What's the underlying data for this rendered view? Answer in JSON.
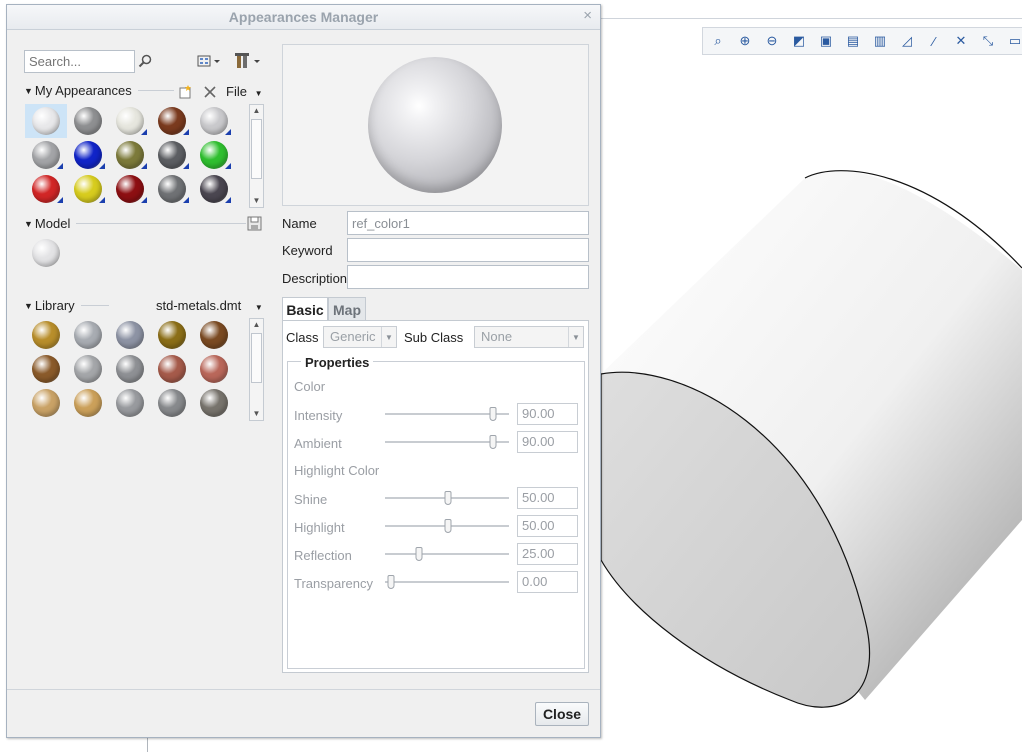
{
  "dialog": {
    "title": "Appearances Manager",
    "close_glyph": "×",
    "search_placeholder": "Search...",
    "my_appearances": {
      "label": "My Appearances",
      "file_menu": "File",
      "swatches": [
        {
          "color": "#e8e8ea",
          "corner": false,
          "selected": true
        },
        {
          "color": "#8e8f91",
          "corner": false
        },
        {
          "color": "#e6e6de",
          "corner": true
        },
        {
          "color": "#7a3a1e",
          "corner": true
        },
        {
          "color": "#c9c9cc",
          "corner": true
        },
        {
          "color": "#a3a4a7",
          "corner": true
        },
        {
          "color": "#1024c8",
          "corner": true
        },
        {
          "color": "#7c7a3a",
          "corner": true
        },
        {
          "color": "#5c5e62",
          "corner": true
        },
        {
          "color": "#2fbf2f",
          "corner": true
        },
        {
          "color": "#d12626",
          "corner": true
        },
        {
          "color": "#d7cc1e",
          "corner": true
        },
        {
          "color": "#8d0f12",
          "corner": true
        },
        {
          "color": "#6f7174",
          "corner": true
        },
        {
          "color": "#4a4650",
          "corner": true
        }
      ]
    },
    "model": {
      "label": "Model",
      "swatches": [
        {
          "color": "#e3e3e5"
        }
      ]
    },
    "library": {
      "label": "Library",
      "file": "std-metals.dmt",
      "swatches": [
        {
          "color": "#b88e2b"
        },
        {
          "color": "#a8acb2"
        },
        {
          "color": "#8d93a4"
        },
        {
          "color": "#8b6e17"
        },
        {
          "color": "#7a4a22"
        },
        {
          "color": "#8a5a2a"
        },
        {
          "color": "#a4a6a9"
        },
        {
          "color": "#8e9094"
        },
        {
          "color": "#a55a4a"
        },
        {
          "color": "#b9675a"
        },
        {
          "color": "#c9a266"
        },
        {
          "color": "#cba05a"
        },
        {
          "color": "#989a9e"
        },
        {
          "color": "#87898c"
        },
        {
          "color": "#77736c"
        }
      ]
    },
    "fields": {
      "name_label": "Name",
      "name_value": "ref_color1",
      "keyword_label": "Keyword",
      "keyword_value": "",
      "description_label": "Description",
      "description_value": ""
    },
    "tabs": {
      "basic": "Basic",
      "map": "Map"
    },
    "basic": {
      "class_label": "Class",
      "class_value": "Generic",
      "subclass_label": "Sub Class",
      "subclass_value": "None",
      "properties_title": "Properties",
      "color_heading": "Color",
      "highlight_heading": "Highlight Color",
      "sliders": [
        {
          "key": "intensity",
          "label": "Intensity",
          "value": "90.00",
          "fraction": 0.9
        },
        {
          "key": "ambient",
          "label": "Ambient",
          "value": "90.00",
          "fraction": 0.9
        },
        {
          "key": "shine",
          "label": "Shine",
          "value": "50.00",
          "fraction": 0.5
        },
        {
          "key": "highlight",
          "label": "Highlight",
          "value": "50.00",
          "fraction": 0.5
        },
        {
          "key": "reflection",
          "label": "Reflection",
          "value": "25.00",
          "fraction": 0.25
        },
        {
          "key": "transparency",
          "label": "Transparency",
          "value": "0.00",
          "fraction": 0.0
        }
      ]
    },
    "close_button": "Close"
  },
  "toolbar": {
    "icons": [
      "zoom-fit-icon",
      "zoom-in-icon",
      "zoom-out-icon",
      "shaded-view-icon",
      "display-style-icon",
      "saved-views-icon",
      "view-manager-icon",
      "plane-display-icon",
      "axis-display-icon",
      "point-display-icon",
      "csys-display-icon",
      "annotation-display-icon"
    ]
  }
}
